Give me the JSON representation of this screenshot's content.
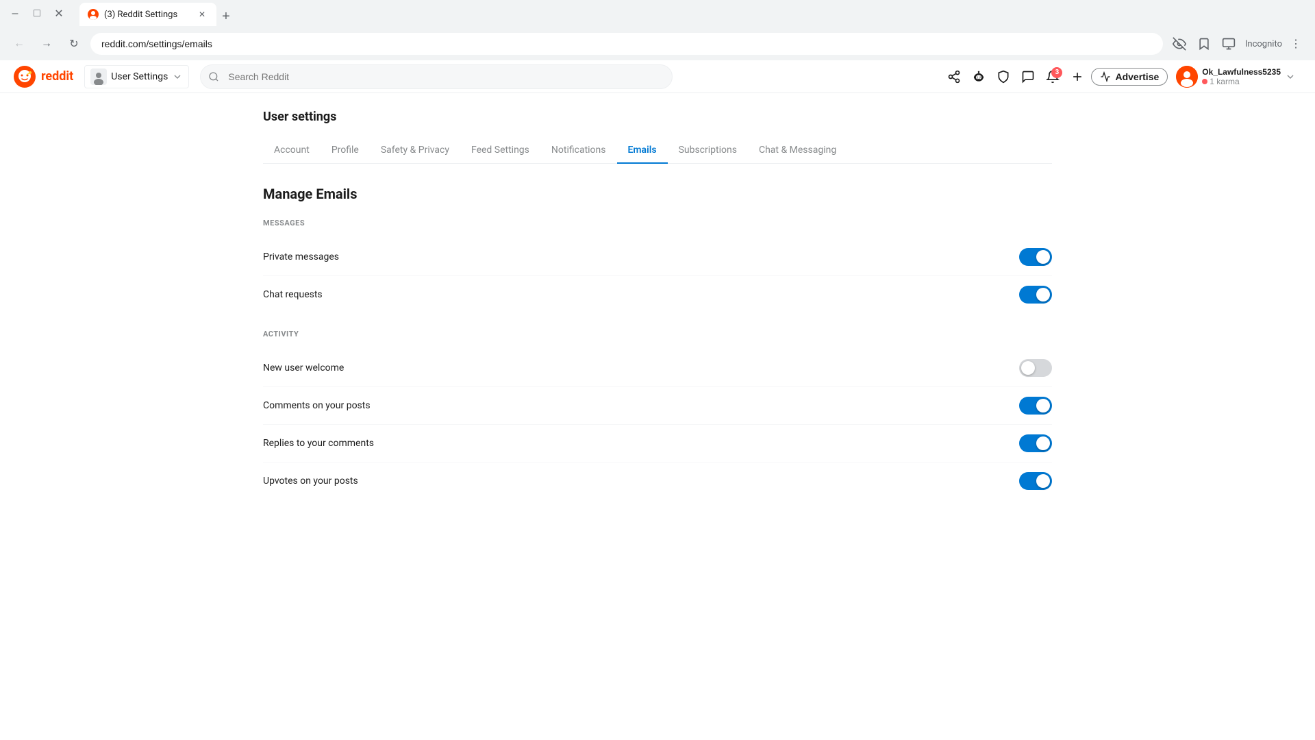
{
  "browser": {
    "tabs": [
      {
        "id": "tab1",
        "title": "(3) Reddit Settings",
        "url": "reddit.com/settings/emails",
        "active": true,
        "favicon_color": "#ff4500"
      }
    ],
    "url": "reddit.com/settings/emails",
    "incognito": true,
    "incognito_label": "Incognito"
  },
  "header": {
    "logo_text": "reddit",
    "user_settings_label": "User Settings",
    "search_placeholder": "Search Reddit",
    "advertise_label": "Advertise",
    "notification_count": "3",
    "user": {
      "name": "Ok_Lawfulness5235",
      "karma": "1 karma"
    }
  },
  "settings": {
    "page_title": "User settings",
    "tabs": [
      {
        "id": "account",
        "label": "Account"
      },
      {
        "id": "profile",
        "label": "Profile"
      },
      {
        "id": "safety",
        "label": "Safety & Privacy"
      },
      {
        "id": "feed",
        "label": "Feed Settings"
      },
      {
        "id": "notifications",
        "label": "Notifications"
      },
      {
        "id": "emails",
        "label": "Emails",
        "active": true
      },
      {
        "id": "subscriptions",
        "label": "Subscriptions"
      },
      {
        "id": "chat",
        "label": "Chat & Messaging"
      }
    ],
    "manage_emails_title": "Manage Emails",
    "sections": [
      {
        "id": "messages",
        "header": "MESSAGES",
        "items": [
          {
            "id": "private-messages",
            "label": "Private messages",
            "enabled": true
          },
          {
            "id": "chat-requests",
            "label": "Chat requests",
            "enabled": true
          }
        ]
      },
      {
        "id": "activity",
        "header": "ACTIVITY",
        "items": [
          {
            "id": "new-user-welcome",
            "label": "New user welcome",
            "enabled": false
          },
          {
            "id": "comments-on-posts",
            "label": "Comments on your posts",
            "enabled": true
          },
          {
            "id": "replies-to-comments",
            "label": "Replies to your comments",
            "enabled": true
          },
          {
            "id": "upvotes-on-posts",
            "label": "Upvotes on your posts",
            "enabled": true
          }
        ]
      }
    ]
  }
}
